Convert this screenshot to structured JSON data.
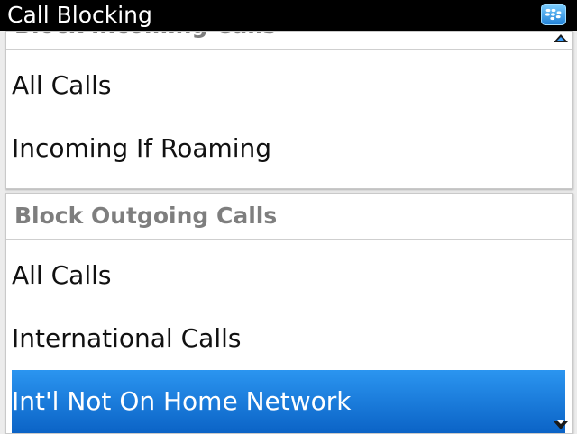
{
  "window": {
    "title": "Call Blocking",
    "app_icon": "blackberry-logo-icon"
  },
  "incoming": {
    "header": "Block Incoming Calls",
    "items": [
      {
        "label": "All Calls",
        "selected": false
      },
      {
        "label": "Incoming If Roaming",
        "selected": false
      }
    ]
  },
  "outgoing": {
    "header": "Block Outgoing Calls",
    "items": [
      {
        "label": "All Calls",
        "selected": false
      },
      {
        "label": "International Calls",
        "selected": false
      },
      {
        "label": "Int'l Not On Home Network",
        "selected": true
      }
    ]
  },
  "scroll_indicators": {
    "up": "scroll-up-arrow-icon",
    "down": "scroll-down-arrow-icon"
  },
  "colors": {
    "titlebar": "#000000",
    "header_text": "#7e7e7e",
    "selection": "#1a7fe0",
    "background": "#ececec"
  }
}
